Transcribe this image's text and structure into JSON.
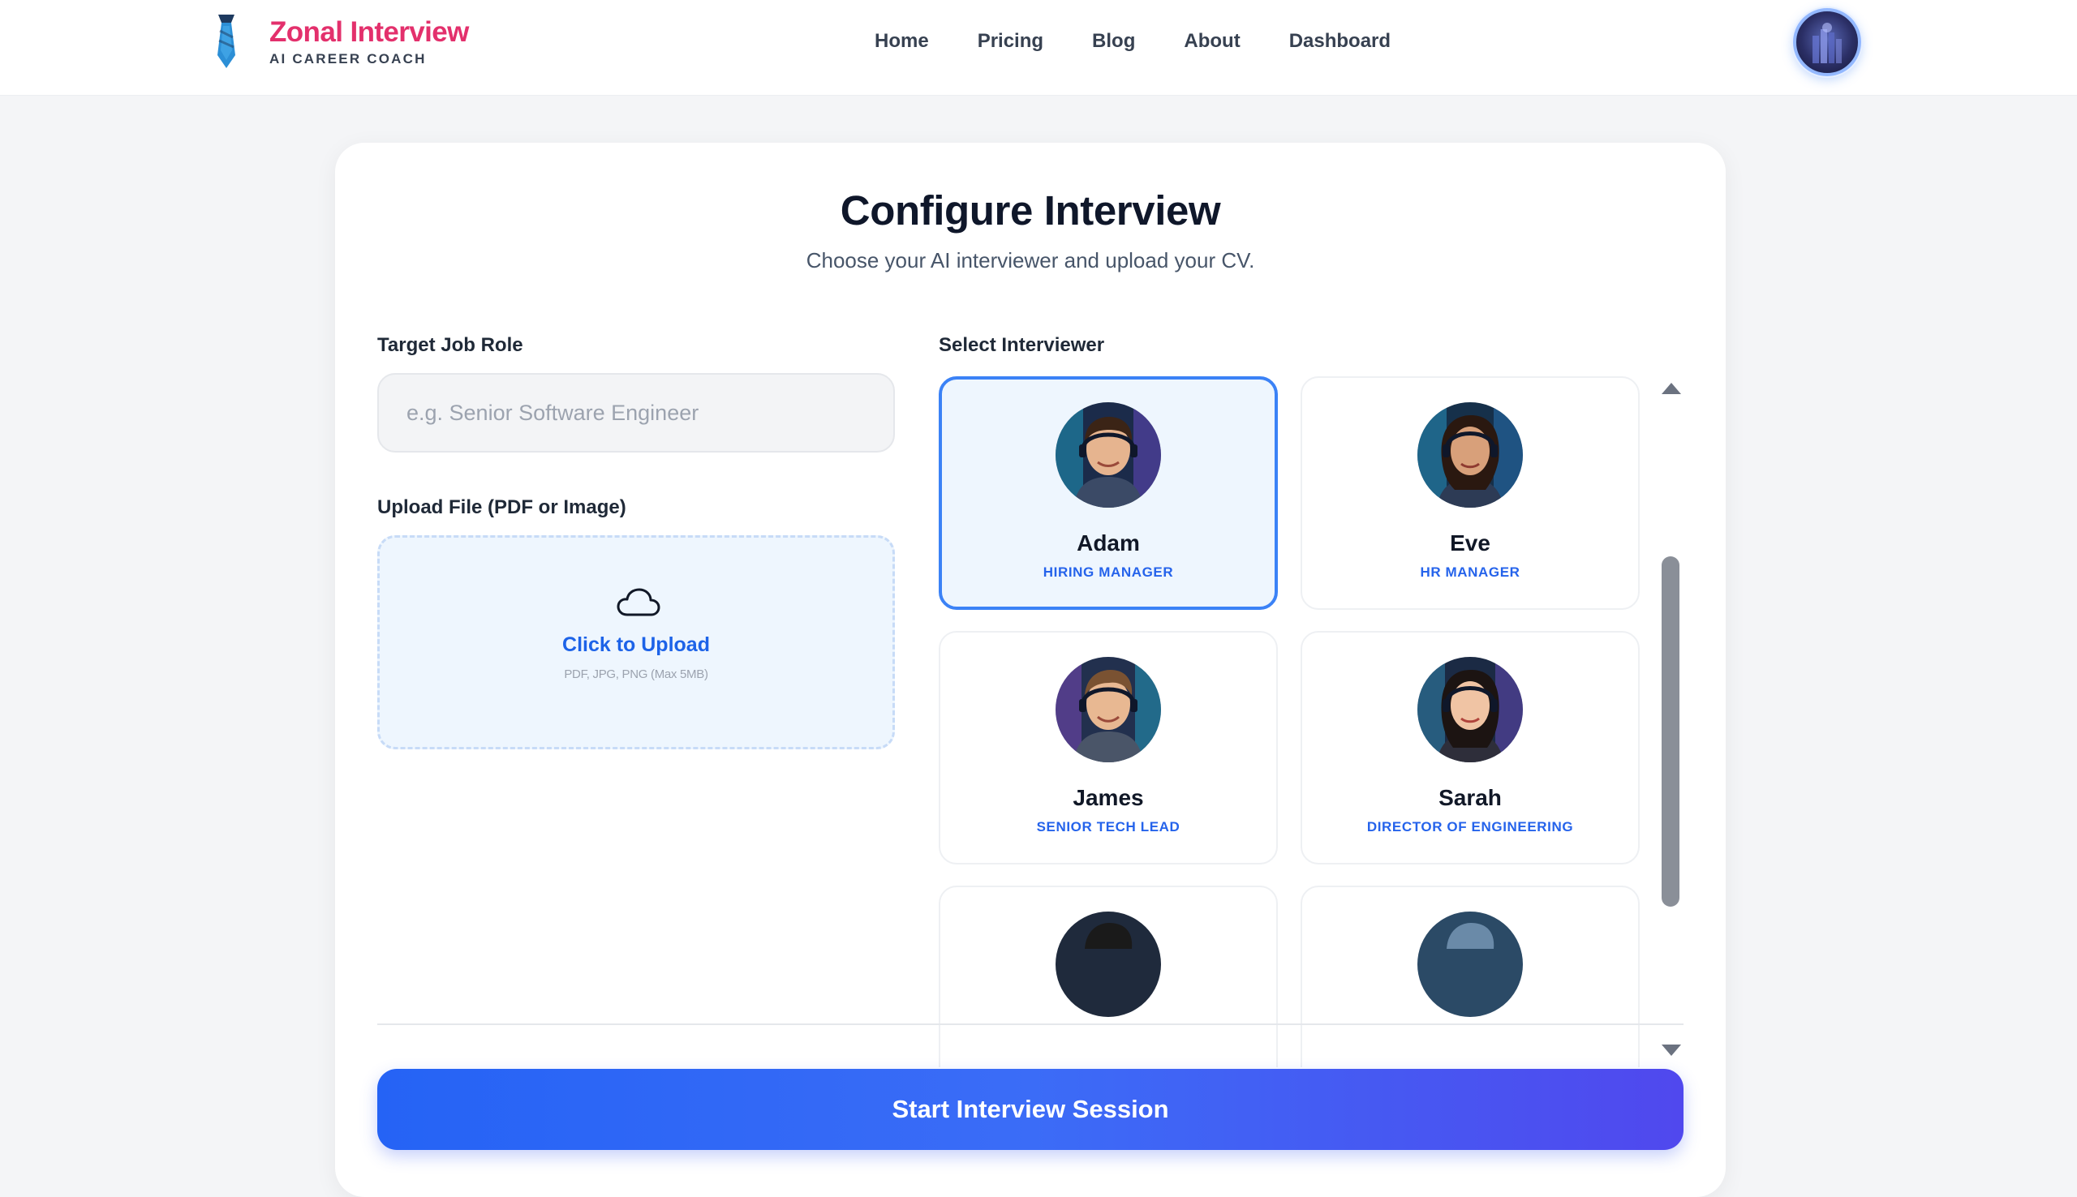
{
  "brand": {
    "title": "Zonal Interview",
    "subtitle": "AI CAREER COACH",
    "logo_icon": "necktie-icon"
  },
  "nav": {
    "items": [
      "Home",
      "Pricing",
      "Blog",
      "About",
      "Dashboard"
    ]
  },
  "user": {
    "avatar_icon": "user-avatar"
  },
  "page": {
    "title": "Configure Interview",
    "subtitle": "Choose your AI interviewer and upload your CV."
  },
  "job_role": {
    "label": "Target Job Role",
    "value": "",
    "placeholder": "e.g. Senior Software Engineer"
  },
  "upload": {
    "label": "Upload File (PDF or Image)",
    "action": "Click to Upload",
    "hint": "PDF, JPG, PNG (Max 5MB)",
    "icon": "cloud-icon"
  },
  "interviewers": {
    "label": "Select Interviewer",
    "selected": "Adam",
    "items": [
      {
        "name": "Adam",
        "role": "HIRING MANAGER"
      },
      {
        "name": "Eve",
        "role": "HR MANAGER"
      },
      {
        "name": "James",
        "role": "SENIOR TECH LEAD"
      },
      {
        "name": "Sarah",
        "role": "DIRECTOR OF ENGINEERING"
      },
      {
        "name": "",
        "role": ""
      },
      {
        "name": "",
        "role": ""
      }
    ]
  },
  "actions": {
    "start": "Start Interview Session"
  },
  "colors": {
    "brand": "#e3306c",
    "accent": "#2563eb",
    "selected_border": "#3b82f6",
    "selected_bg": "#eef6fe",
    "button_gradient_start": "#2563f5",
    "button_gradient_end": "#5048ee"
  }
}
